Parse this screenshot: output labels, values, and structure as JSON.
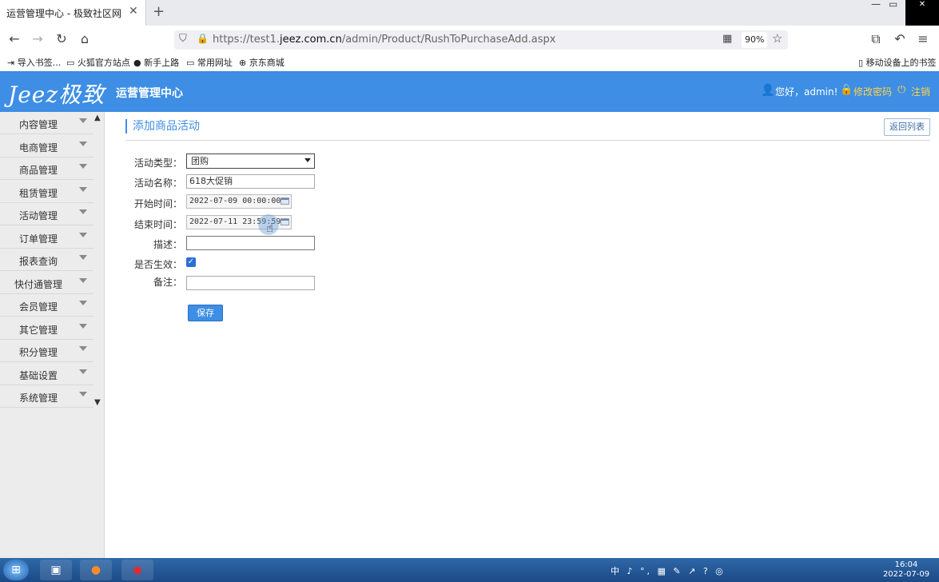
{
  "browser": {
    "tab_title": "运营管理中心 - 极致社区网",
    "tab_close": "✕",
    "new_tab": "+",
    "url_prefix": "https://test1.",
    "url_host": "jeez.com.cn",
    "url_path": "/admin/Product/RushToPurchaseAdd.aspx",
    "zoom": "90%",
    "bookmarks": [
      "导入书签...",
      "火狐官方站点",
      "新手上路",
      "常用网址",
      "京东商城"
    ],
    "mobile_bookmarks": "移动设备上的书签"
  },
  "header": {
    "logo_text": "Jeez极致",
    "app_title": "运营管理中心",
    "greeting": "您好，admin!",
    "change_password": "修改密码",
    "logout": "注销"
  },
  "sidebar": {
    "items": [
      {
        "label": "内容管理"
      },
      {
        "label": "电商管理"
      },
      {
        "label": "商品管理"
      },
      {
        "label": "租赁管理"
      },
      {
        "label": "活动管理"
      },
      {
        "label": "订单管理"
      },
      {
        "label": "报表查询"
      },
      {
        "label": "快付通管理"
      },
      {
        "label": "会员管理"
      },
      {
        "label": "其它管理"
      },
      {
        "label": "积分管理"
      },
      {
        "label": "基础设置"
      },
      {
        "label": "系统管理"
      }
    ]
  },
  "main": {
    "page_title": "添加商品活动",
    "back_button": "返回列表",
    "form": {
      "type_label": "活动类型：",
      "type_value": "团购",
      "name_label": "活动名称：",
      "name_value": "618大促销",
      "start_label": "开始时间：",
      "start_value": "2022-07-09 00:00:00",
      "end_label": "结束时间：",
      "end_value": "2022-07-11 23:59:59",
      "desc_label": "描述：",
      "desc_value": "",
      "active_label": "是否生效：",
      "active_checked": true,
      "remark_label": "备注：",
      "remark_value": "",
      "save_button": "保存"
    }
  },
  "taskbar": {
    "tray_text": "中 ♪ °, ▦ ✎ ↗ ? ◎",
    "clock_time": "16:04",
    "clock_date": "2022-07-09"
  },
  "colors": {
    "accent": "#3d8ee4",
    "header_link": "#ffd34a"
  }
}
